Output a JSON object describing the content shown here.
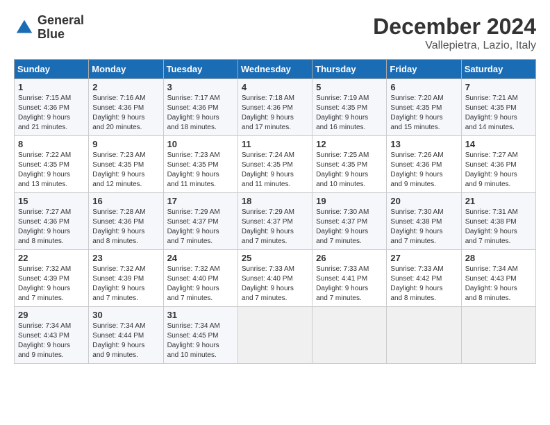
{
  "logo": {
    "line1": "General",
    "line2": "Blue"
  },
  "title": "December 2024",
  "subtitle": "Vallepietra, Lazio, Italy",
  "weekdays": [
    "Sunday",
    "Monday",
    "Tuesday",
    "Wednesday",
    "Thursday",
    "Friday",
    "Saturday"
  ],
  "weeks": [
    [
      {
        "day": "1",
        "info": "Sunrise: 7:15 AM\nSunset: 4:36 PM\nDaylight: 9 hours\nand 21 minutes."
      },
      {
        "day": "2",
        "info": "Sunrise: 7:16 AM\nSunset: 4:36 PM\nDaylight: 9 hours\nand 20 minutes."
      },
      {
        "day": "3",
        "info": "Sunrise: 7:17 AM\nSunset: 4:36 PM\nDaylight: 9 hours\nand 18 minutes."
      },
      {
        "day": "4",
        "info": "Sunrise: 7:18 AM\nSunset: 4:36 PM\nDaylight: 9 hours\nand 17 minutes."
      },
      {
        "day": "5",
        "info": "Sunrise: 7:19 AM\nSunset: 4:35 PM\nDaylight: 9 hours\nand 16 minutes."
      },
      {
        "day": "6",
        "info": "Sunrise: 7:20 AM\nSunset: 4:35 PM\nDaylight: 9 hours\nand 15 minutes."
      },
      {
        "day": "7",
        "info": "Sunrise: 7:21 AM\nSunset: 4:35 PM\nDaylight: 9 hours\nand 14 minutes."
      }
    ],
    [
      {
        "day": "8",
        "info": "Sunrise: 7:22 AM\nSunset: 4:35 PM\nDaylight: 9 hours\nand 13 minutes."
      },
      {
        "day": "9",
        "info": "Sunrise: 7:23 AM\nSunset: 4:35 PM\nDaylight: 9 hours\nand 12 minutes."
      },
      {
        "day": "10",
        "info": "Sunrise: 7:23 AM\nSunset: 4:35 PM\nDaylight: 9 hours\nand 11 minutes."
      },
      {
        "day": "11",
        "info": "Sunrise: 7:24 AM\nSunset: 4:35 PM\nDaylight: 9 hours\nand 11 minutes."
      },
      {
        "day": "12",
        "info": "Sunrise: 7:25 AM\nSunset: 4:35 PM\nDaylight: 9 hours\nand 10 minutes."
      },
      {
        "day": "13",
        "info": "Sunrise: 7:26 AM\nSunset: 4:36 PM\nDaylight: 9 hours\nand 9 minutes."
      },
      {
        "day": "14",
        "info": "Sunrise: 7:27 AM\nSunset: 4:36 PM\nDaylight: 9 hours\nand 9 minutes."
      }
    ],
    [
      {
        "day": "15",
        "info": "Sunrise: 7:27 AM\nSunset: 4:36 PM\nDaylight: 9 hours\nand 8 minutes."
      },
      {
        "day": "16",
        "info": "Sunrise: 7:28 AM\nSunset: 4:36 PM\nDaylight: 9 hours\nand 8 minutes."
      },
      {
        "day": "17",
        "info": "Sunrise: 7:29 AM\nSunset: 4:37 PM\nDaylight: 9 hours\nand 7 minutes."
      },
      {
        "day": "18",
        "info": "Sunrise: 7:29 AM\nSunset: 4:37 PM\nDaylight: 9 hours\nand 7 minutes."
      },
      {
        "day": "19",
        "info": "Sunrise: 7:30 AM\nSunset: 4:37 PM\nDaylight: 9 hours\nand 7 minutes."
      },
      {
        "day": "20",
        "info": "Sunrise: 7:30 AM\nSunset: 4:38 PM\nDaylight: 9 hours\nand 7 minutes."
      },
      {
        "day": "21",
        "info": "Sunrise: 7:31 AM\nSunset: 4:38 PM\nDaylight: 9 hours\nand 7 minutes."
      }
    ],
    [
      {
        "day": "22",
        "info": "Sunrise: 7:32 AM\nSunset: 4:39 PM\nDaylight: 9 hours\nand 7 minutes."
      },
      {
        "day": "23",
        "info": "Sunrise: 7:32 AM\nSunset: 4:39 PM\nDaylight: 9 hours\nand 7 minutes."
      },
      {
        "day": "24",
        "info": "Sunrise: 7:32 AM\nSunset: 4:40 PM\nDaylight: 9 hours\nand 7 minutes."
      },
      {
        "day": "25",
        "info": "Sunrise: 7:33 AM\nSunset: 4:40 PM\nDaylight: 9 hours\nand 7 minutes."
      },
      {
        "day": "26",
        "info": "Sunrise: 7:33 AM\nSunset: 4:41 PM\nDaylight: 9 hours\nand 7 minutes."
      },
      {
        "day": "27",
        "info": "Sunrise: 7:33 AM\nSunset: 4:42 PM\nDaylight: 9 hours\nand 8 minutes."
      },
      {
        "day": "28",
        "info": "Sunrise: 7:34 AM\nSunset: 4:43 PM\nDaylight: 9 hours\nand 8 minutes."
      }
    ],
    [
      {
        "day": "29",
        "info": "Sunrise: 7:34 AM\nSunset: 4:43 PM\nDaylight: 9 hours\nand 9 minutes."
      },
      {
        "day": "30",
        "info": "Sunrise: 7:34 AM\nSunset: 4:44 PM\nDaylight: 9 hours\nand 9 minutes."
      },
      {
        "day": "31",
        "info": "Sunrise: 7:34 AM\nSunset: 4:45 PM\nDaylight: 9 hours\nand 10 minutes."
      },
      {
        "day": "",
        "info": ""
      },
      {
        "day": "",
        "info": ""
      },
      {
        "day": "",
        "info": ""
      },
      {
        "day": "",
        "info": ""
      }
    ]
  ]
}
